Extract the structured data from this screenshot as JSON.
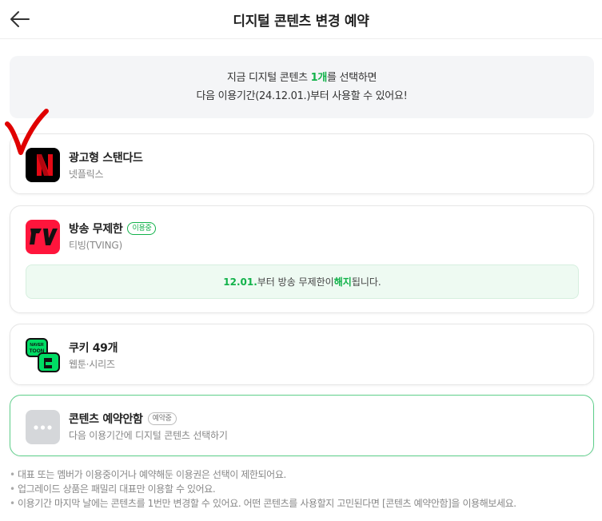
{
  "header": {
    "title": "디지털 콘텐츠 변경 예약"
  },
  "notice": {
    "line1_before": "지금 디지털 콘텐츠 ",
    "line1_count": "1개",
    "line1_after": "를 선택하면",
    "line2": "다음 이용기간(24.12.01.)부터 사용할 수 있어요!"
  },
  "items": [
    {
      "name": "광고형 스탠다드",
      "provider": "넷플릭스",
      "logo_icon": "netflix-logo-icon"
    },
    {
      "name": "방송 무제한",
      "badge": "이용중",
      "provider": "티빙(TVING)",
      "logo_icon": "tving-logo-icon",
      "notice_date": "12.01.",
      "notice_mid": "부터 방송 무제한이 ",
      "notice_keyword": "해지",
      "notice_end": "됩니다."
    },
    {
      "name": "쿠키 49개",
      "provider": "웹툰·시리즈",
      "logo_icon": "naver-webtoon-logo-icon",
      "logo_text_top": "NAVER",
      "logo_text_bottom": "TOON"
    },
    {
      "name": "콘텐츠 예약안함",
      "badge": "예약중",
      "provider": "다음 이용기간에 디지털 콘텐츠 선택하기",
      "logo_icon": "more-dots-icon"
    }
  ],
  "footnotes": [
    "대표 또는 멤버가 이용중이거나 예약해둔 이용권은 선택이 제한되어요.",
    "업그레이드 상품은 패밀리 대표만 이용할 수 있어요.",
    "이용기간 마지막 날에는 콘텐츠를 1번만 변경할 수 있어요. 어떤 콘텐츠를 사용할지 고민된다면 [콘텐츠 예약안함]을 이용해보세요."
  ],
  "colors": {
    "accent": "#12b24a",
    "netflix": "#e50914",
    "tving": "#ff153c",
    "webtoon": "#00dc64",
    "check": "#e00000"
  }
}
